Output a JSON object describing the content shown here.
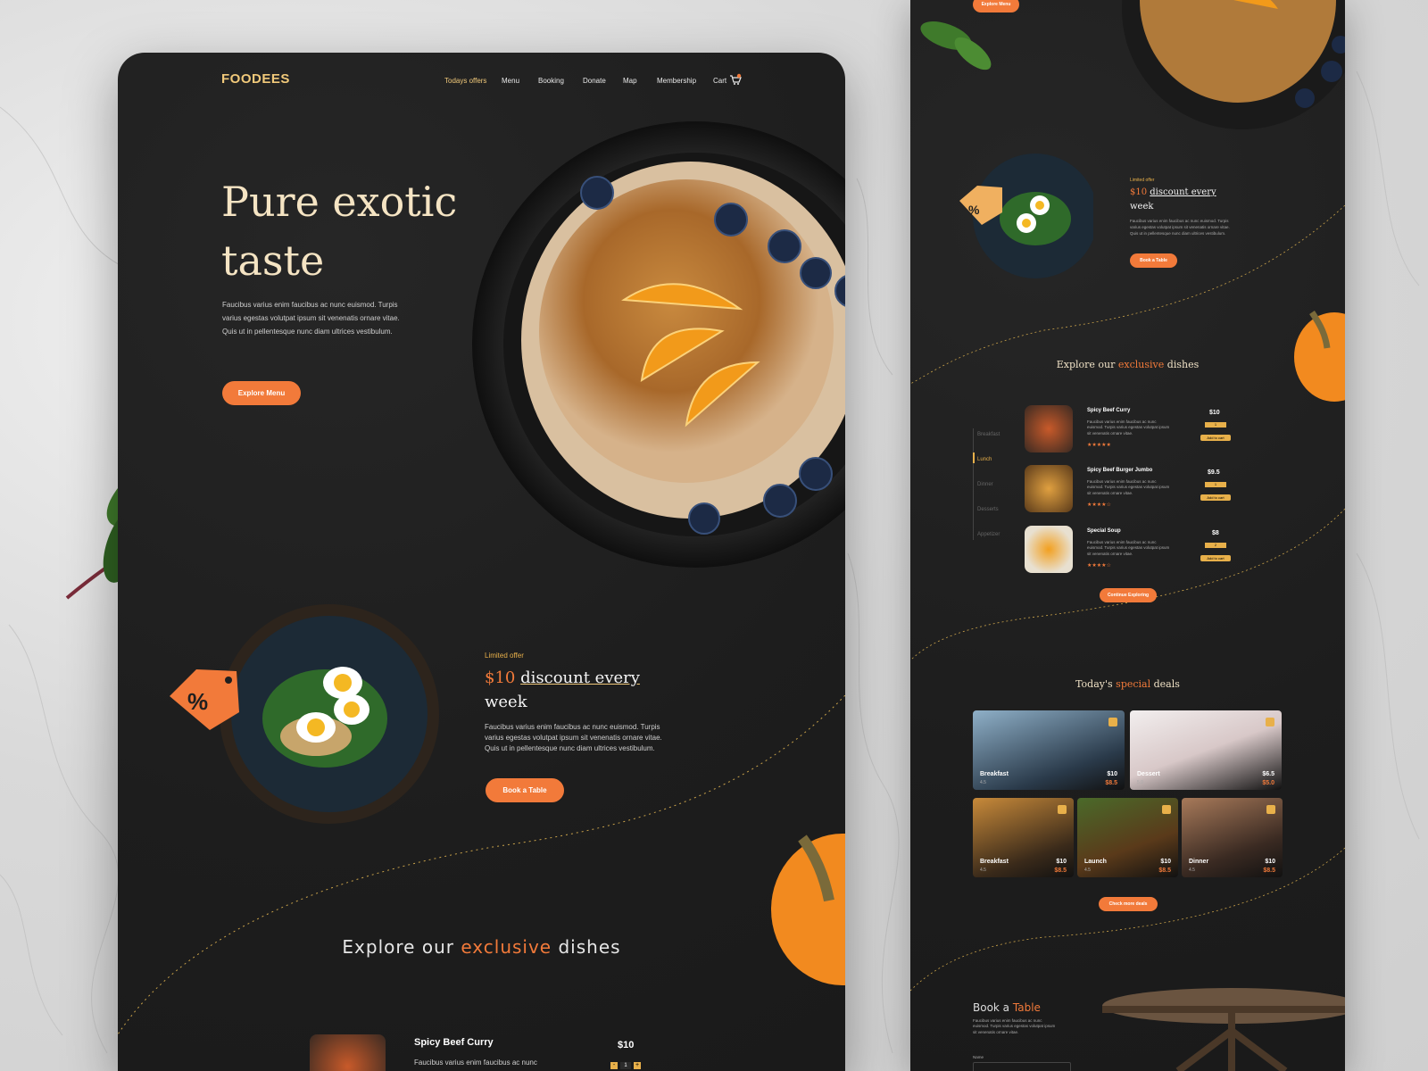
{
  "brand": "FOODEES",
  "nav": {
    "items": [
      "Todays offers",
      "Menu",
      "Booking",
      "Donate",
      "Map",
      "Membership",
      "Cart"
    ],
    "active_index": 0,
    "cart_badge_color": "#f27a3a"
  },
  "hero": {
    "title_line1": "Pure exotic",
    "title_line2": "taste",
    "description": "Faucibus varius enim faucibus ac nunc euismod. Turpis varius egestas volutpat ipsum sit venenatis ornare vitae. Quis ut in pellentesque nunc diam ultrices vestibulum.",
    "cta": "Explore Menu"
  },
  "offer": {
    "eyebrow": "Limited offer",
    "price": "$10",
    "title_a": "discount every",
    "title_b": "week",
    "description": "Faucibus varius enim faucibus ac nunc euismod. Turpis varius egestas volutpat ipsum sit venenatis ornare vitae. Quis ut in pellentesque nunc diam ultrices vestibulum.",
    "cta": "Book a Table",
    "tag_icon": "percent-tag-icon"
  },
  "explore": {
    "title_pre": "Explore our",
    "title_highlight": "exclusive",
    "title_post": "dishes",
    "first_dish": {
      "name": "Spicy Beef Curry",
      "description": "Faucibus varius enim faucibus ac nunc",
      "price": "$10",
      "qty": "1"
    }
  },
  "side": {
    "top_cta": "Explore Menu",
    "offer": {
      "eyebrow": "Limited offer",
      "price": "$10",
      "title_a": "discount every",
      "title_b": "week",
      "description": "Faucibus varius enim faucibus ac nunc euismod. Turpis varius egestas volutpat ipsum sit venenatis ornare vitae. Quis ut in pellentesque nunc diam ultrices vestibulum.",
      "cta": "Book a Table"
    },
    "explore_title_pre": "Explore our",
    "explore_title_highlight": "exclusive",
    "explore_title_post": "dishes",
    "categories": [
      "Breakfast",
      "Lunch",
      "Dinner",
      "Desserts",
      "Appetizer"
    ],
    "active_category": 1,
    "dishes": [
      {
        "name": "Spicy Beef Curry",
        "description": "Faucibus varius enim faucibus ac nunc euismod. Turpis varius egestas volutpat ipsum sit venenatis ornare vitae.",
        "price": "$10",
        "qty": "1",
        "stars": 5,
        "add": "Add to cart"
      },
      {
        "name": "Spicy Beef Burger Jumbo",
        "description": "Faucibus varius enim faucibus ac nunc euismod. Turpis varius egestas volutpat ipsum sit venenatis ornare vitae.",
        "price": "$9.5",
        "qty": "1",
        "stars": 4.5,
        "add": "Add to cart"
      },
      {
        "name": "Special Soup",
        "description": "Faucibus varius enim faucibus ac nunc euismod. Turpis varius egestas volutpat ipsum sit venenatis ornare vitae.",
        "price": "$8",
        "qty": "2",
        "stars": 4,
        "add": "Add to cart"
      }
    ],
    "continue_cta": "Continue Exploring",
    "deals_title_pre": "Today's",
    "deals_title_highlight": "special",
    "deals_title_post": "deals",
    "deals": [
      {
        "label": "Breakfast",
        "rating": "4.5",
        "old_price": "$10",
        "price": "$8.5"
      },
      {
        "label": "Dessert",
        "rating": "5.0",
        "old_price": "$6.5",
        "price": "$5.0"
      },
      {
        "label": "Breakfast",
        "rating": "4.5",
        "old_price": "$10",
        "price": "$8.5"
      },
      {
        "label": "Launch",
        "rating": "4.5",
        "old_price": "$10",
        "price": "$8.5"
      },
      {
        "label": "Dinner",
        "rating": "4.5",
        "old_price": "$10",
        "price": "$8.5"
      }
    ],
    "deals_cta": "Check more deals",
    "book_title_pre": "Book a",
    "book_title_highlight": "Table",
    "book_description": "Faucibus varius enim faucibus ac nunc euismod. Turpis varius egestas volutpat ipsum sit venenatis ornare vitae.",
    "name_label": "Name"
  }
}
